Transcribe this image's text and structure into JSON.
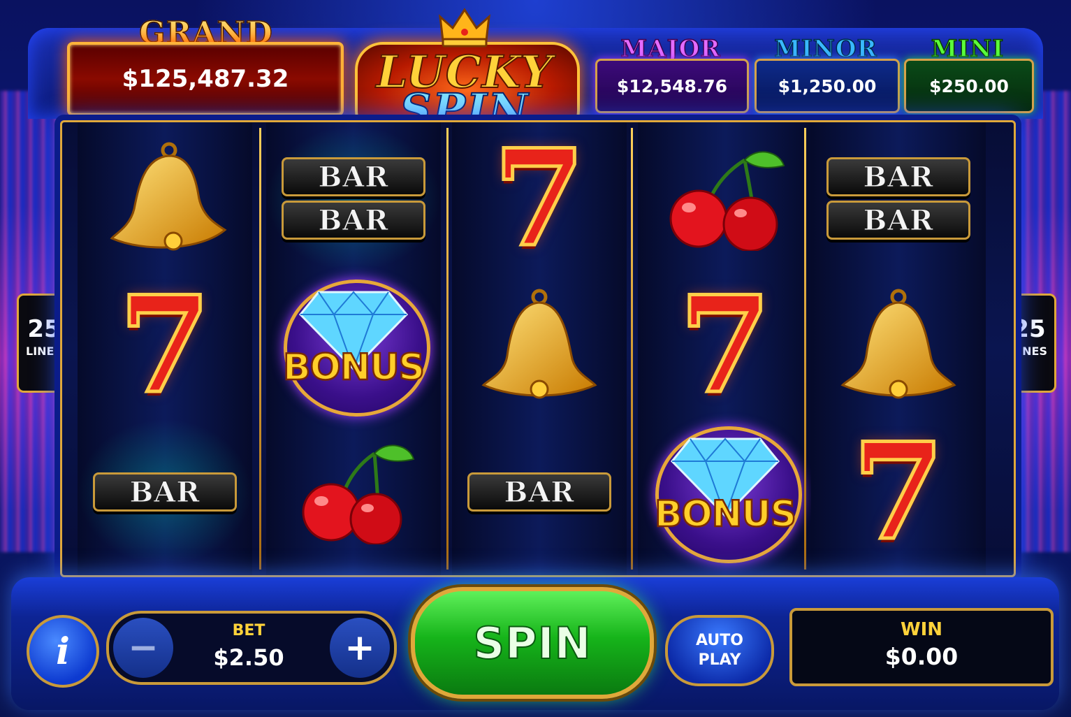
{
  "jackpots": {
    "grand": {
      "title": "GRAND",
      "amount": "$125,487.32"
    },
    "major": {
      "title": "MAJOR",
      "amount": "$12,548.76"
    },
    "minor": {
      "title": "MINOR",
      "amount": "$1,250.00"
    },
    "mini": {
      "title": "MINI",
      "amount": "$250.00"
    }
  },
  "logo": {
    "line1": "LUCKY",
    "line2": "SPIN"
  },
  "paylines": {
    "count": "25",
    "label": "LINES"
  },
  "reels": [
    [
      {
        "symbol": "bell"
      },
      {
        "symbol": "seven",
        "text": "7"
      },
      {
        "symbol": "bar",
        "text": "BAR"
      }
    ],
    [
      {
        "symbol": "double-bar",
        "text": "BAR"
      },
      {
        "symbol": "bonus-diamond",
        "text": "BONUS"
      },
      {
        "symbol": "cherry"
      }
    ],
    [
      {
        "symbol": "seven",
        "text": "7"
      },
      {
        "symbol": "bell"
      },
      {
        "symbol": "bar",
        "text": "BAR"
      }
    ],
    [
      {
        "symbol": "cherry"
      },
      {
        "symbol": "seven",
        "text": "7"
      },
      {
        "symbol": "bonus-diamond",
        "text": "BONUS"
      }
    ],
    [
      {
        "symbol": "double-bar",
        "text": "BAR"
      },
      {
        "symbol": "bell"
      },
      {
        "symbol": "seven",
        "text": "7"
      }
    ]
  ],
  "controls": {
    "info_icon": "i",
    "bet_label": "BET",
    "bet_value": "$2.50",
    "minus": "−",
    "plus": "+",
    "spin": "SPIN",
    "auto_line1": "AUTO",
    "auto_line2": "PLAY",
    "win_label": "WIN",
    "win_value": "$0.00"
  },
  "colors": {
    "accent_gold": "#e0a83a",
    "spin_green": "#16b41a",
    "grand_red": "#8a0a00",
    "major_purple": "#3c0a7a",
    "minor_blue": "#0d2a8a",
    "mini_green": "#0a4a18"
  }
}
